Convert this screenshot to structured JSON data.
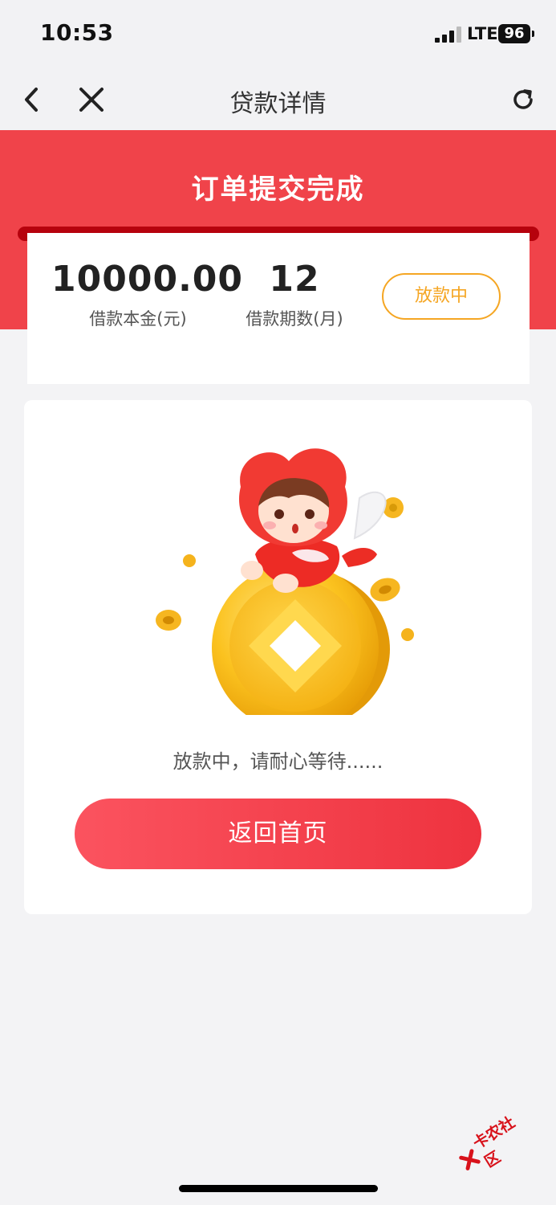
{
  "status_bar": {
    "time": "10:53",
    "network": "LTE",
    "battery": "96"
  },
  "nav": {
    "title": "贷款详情",
    "back_icon": "chevron-left-icon",
    "close_icon": "close-icon",
    "refresh_icon": "refresh-icon"
  },
  "banner": {
    "title": "订单提交完成"
  },
  "loan": {
    "amount": "10000.00",
    "amount_label": "借款本金(元)",
    "term": "12",
    "term_label": "借款期数(月)",
    "status": "放款中"
  },
  "main": {
    "illustration": "mascot-on-gold-coin",
    "message": "放款中，请耐心等待......",
    "home_button": "返回首页"
  },
  "watermark": {
    "text": "卡农社区"
  },
  "colors": {
    "brand_red": "#f0434a",
    "status_orange": "#f5a623",
    "button_red": "#f13a45"
  }
}
